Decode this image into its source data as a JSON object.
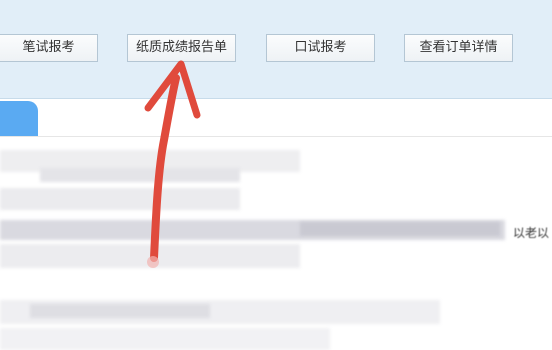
{
  "toolbar": {
    "written_report_label": "笔试报考",
    "paper_report_label": "纸质成绩报告单",
    "oral_report_label": "口试报考",
    "order_details_label": "查看订单详情"
  },
  "content": {
    "partial_trailing_text": "以老以"
  },
  "colors": {
    "toolbar_bg": "#e1eef8",
    "tab_accent": "#5aaaf2",
    "annotation_arrow": "#e04a3c"
  }
}
